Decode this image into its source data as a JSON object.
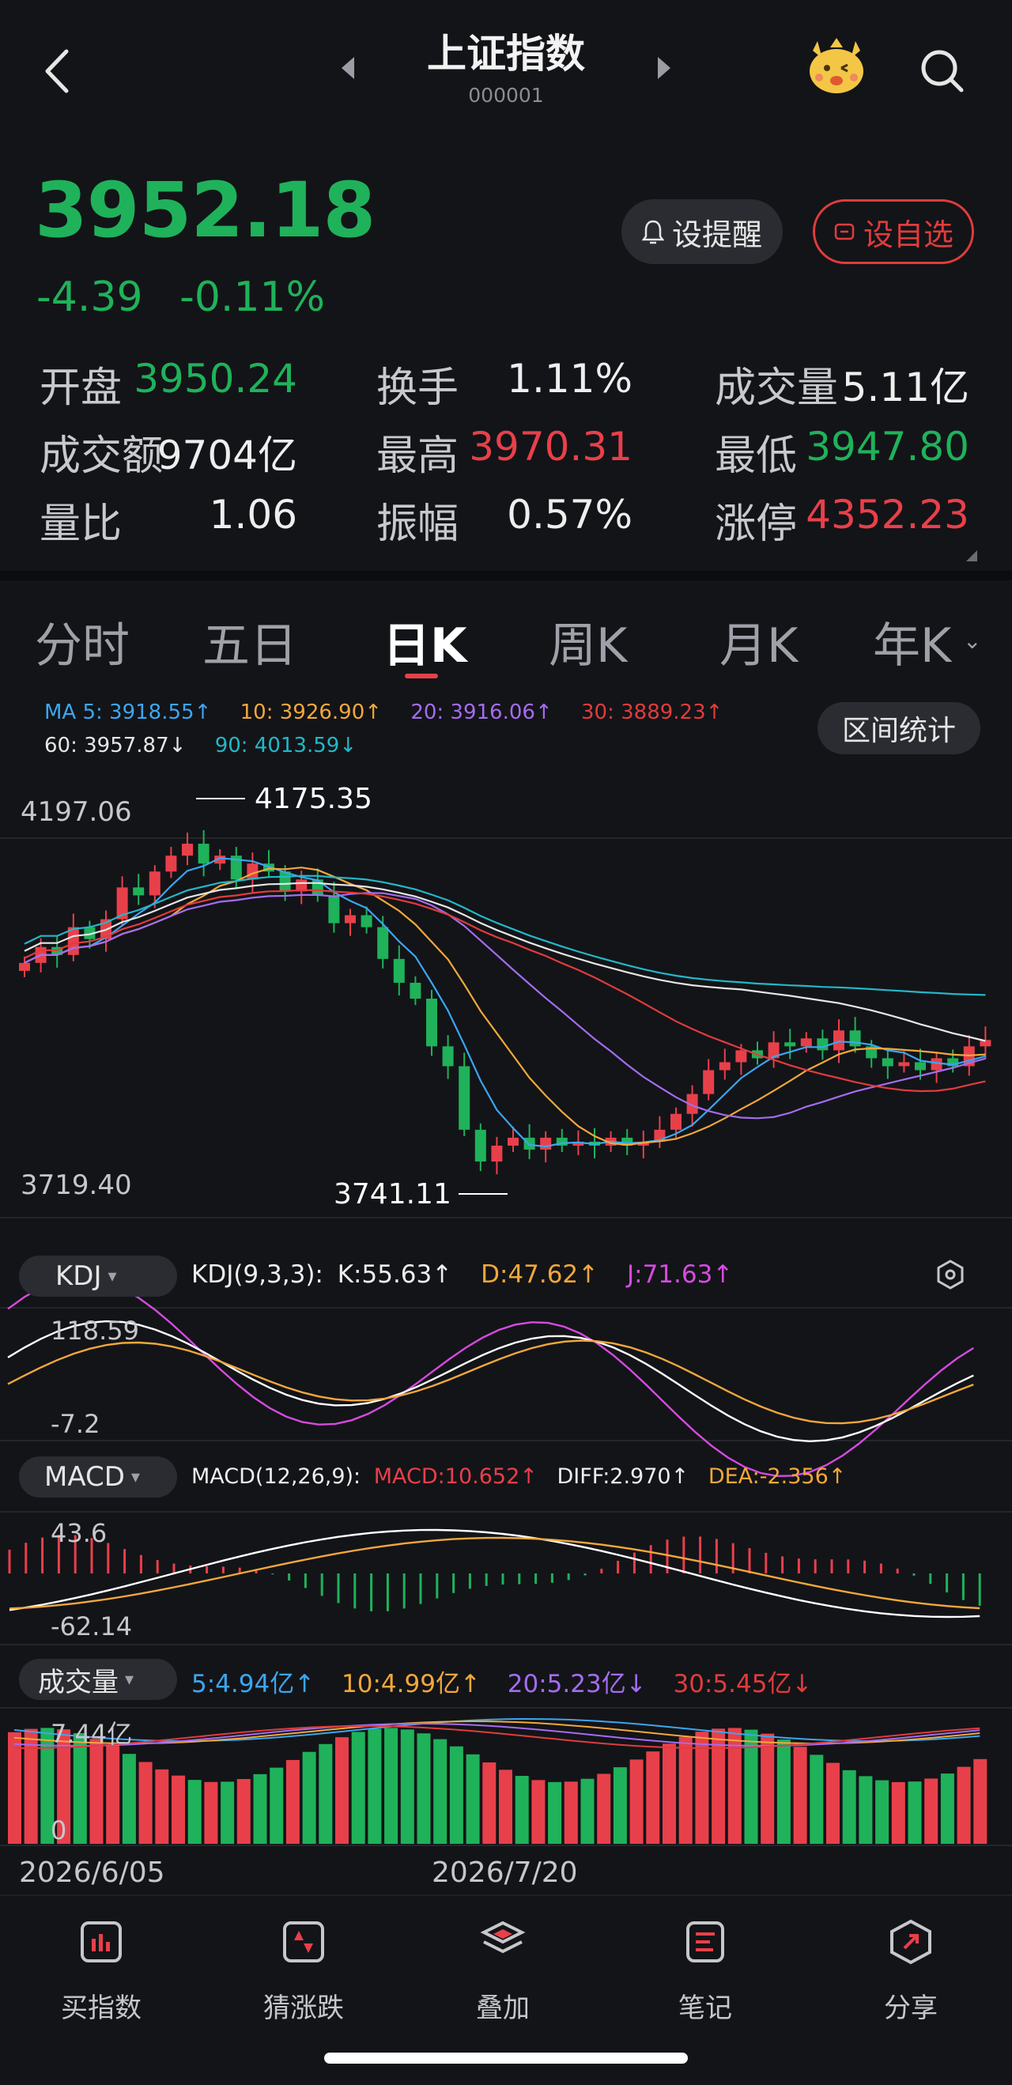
{
  "header": {
    "title": "上证指数",
    "code": "000001"
  },
  "quote": {
    "price": "3952.18",
    "change": "-4.39",
    "change_pct": "-0.11%",
    "alert_label": "设提醒",
    "watch_label": "设自选",
    "stats": [
      {
        "label": "开盘",
        "value": "3950.24",
        "color": "green"
      },
      {
        "label": "换手",
        "value": "1.11%",
        "color": "white"
      },
      {
        "label": "成交量",
        "value": "5.11亿",
        "color": "white"
      },
      {
        "label": "成交额",
        "value": "9704亿",
        "color": "white"
      },
      {
        "label": "最高",
        "value": "3970.31",
        "color": "red"
      },
      {
        "label": "最低",
        "value": "3947.80",
        "color": "green"
      },
      {
        "label": "量比",
        "value": "1.06",
        "color": "white"
      },
      {
        "label": "振幅",
        "value": "0.57%",
        "color": "white"
      },
      {
        "label": "涨停",
        "value": "4352.23",
        "color": "red"
      }
    ]
  },
  "tabs": [
    "分时",
    "五日",
    "日K",
    "周K",
    "月K",
    "年K"
  ],
  "active_tab": "日K",
  "ma_legend": {
    "ma5": "MA 5: 3918.55↑",
    "ma10": "10: 3926.90↑",
    "ma20": "20: 3916.06↑",
    "ma30": "30: 3889.23↑",
    "ma60": "60: 3957.87↓",
    "ma90": "90: 4013.59↓"
  },
  "range_stats_label": "区间统计",
  "kline_axis": {
    "top": "4197.06",
    "bottom": "3719.40",
    "high_mark": "4175.35",
    "low_mark": "3741.11"
  },
  "kdj": {
    "label": "KDJ",
    "params": "KDJ(9,3,3):",
    "k": "K:55.63↑",
    "d": "D:47.62↑",
    "j": "J:71.63↑",
    "top": "118.59",
    "bottom": "-7.2"
  },
  "macd": {
    "label": "MACD",
    "params": "MACD(12,26,9):",
    "macd": "MACD:10.652↑",
    "diff": "DIFF:2.970↑",
    "dea": "DEA:-2.356↑",
    "top": "43.6",
    "bottom": "-62.14"
  },
  "volume": {
    "label": "成交量",
    "v5": "5:4.94亿↑",
    "v10": "10:4.99亿↑",
    "v20": "20:5.23亿↓",
    "v30": "30:5.45亿↓",
    "top": "7.44亿",
    "bottom": "0"
  },
  "dates": {
    "start": "2026/6/05",
    "mid": "2026/7/20"
  },
  "bottom_nav": [
    {
      "label": "买指数",
      "icon": "bar-chart-icon"
    },
    {
      "label": "猜涨跌",
      "icon": "updown-icon"
    },
    {
      "label": "叠加",
      "icon": "layers-icon"
    },
    {
      "label": "笔记",
      "icon": "note-icon"
    },
    {
      "label": "分享",
      "icon": "share-icon"
    }
  ],
  "colors": {
    "up": "#e8404a",
    "down": "#1fb25a",
    "ma5": "#3ba6f2",
    "ma10": "#f1a83b",
    "ma20": "#a46cf0",
    "ma30": "#e03c3c",
    "ma60": "#e6e6e6",
    "ma90": "#22b8c8",
    "kdj_j": "#d64be0"
  }
}
